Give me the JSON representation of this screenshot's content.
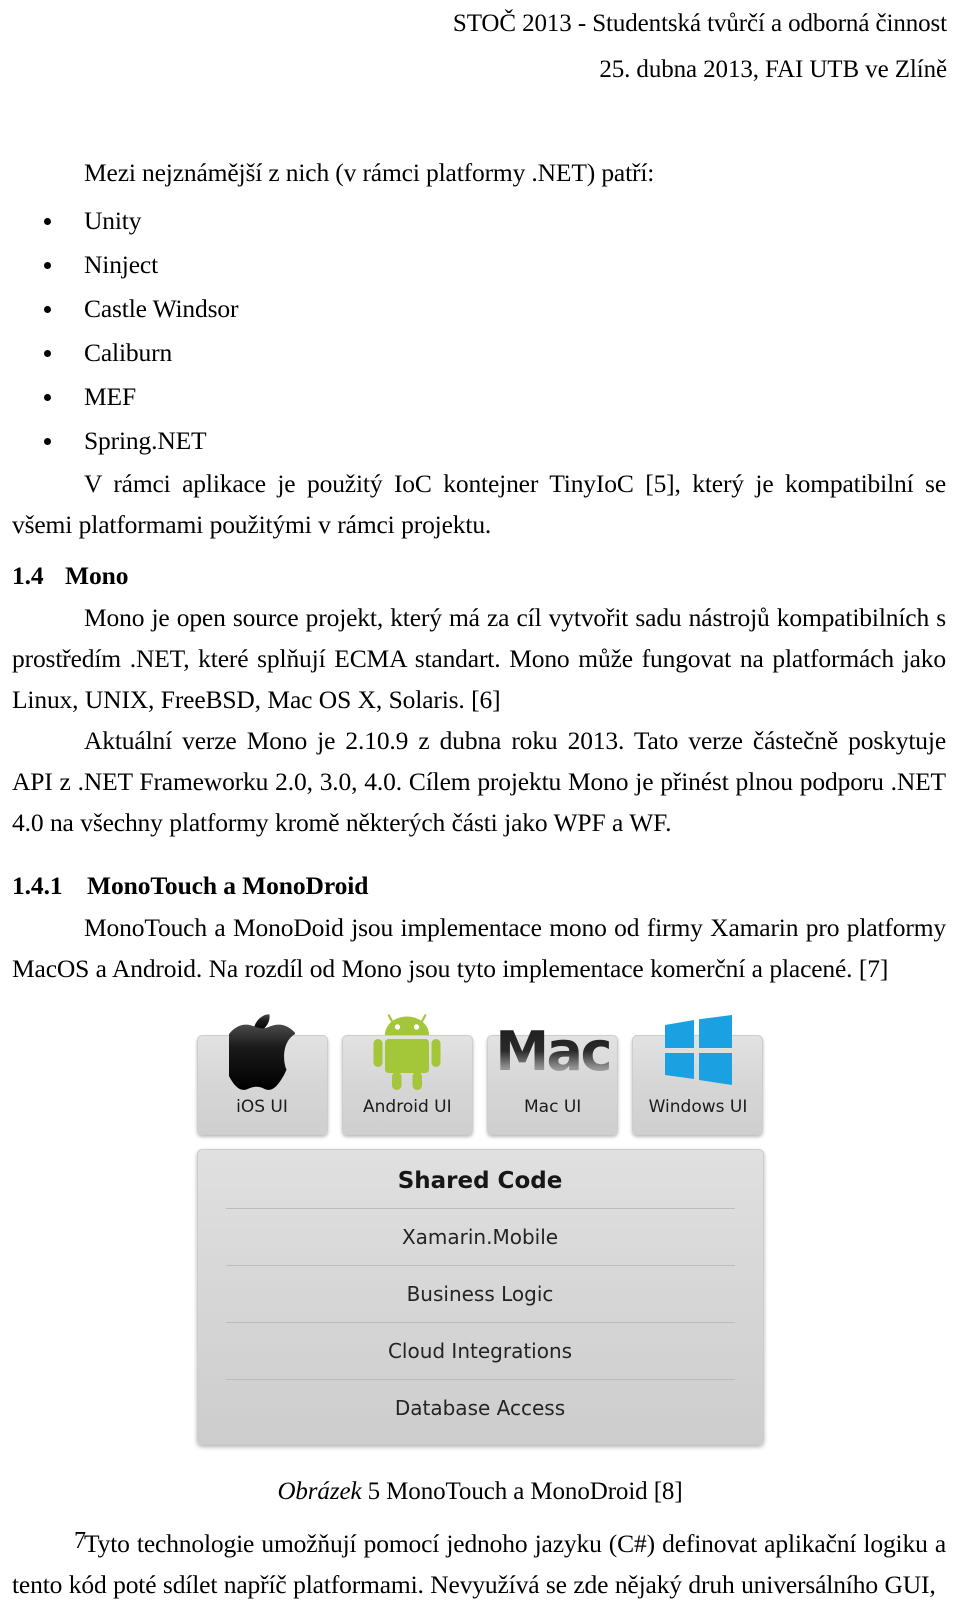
{
  "header": {
    "line1": "STOČ 2013 - Studentská tvůrčí a odborná činnost",
    "line2": "25. dubna 2013, FAI UTB ve Zlíně"
  },
  "content": {
    "intro_line": "Mezi nejznámější z nich (v rámci platformy .NET) patří:",
    "bullets": [
      {
        "label": "Unity"
      },
      {
        "label": "Ninject"
      },
      {
        "label": "Castle Windsor"
      },
      {
        "label": "Caliburn"
      },
      {
        "label": "MEF"
      },
      {
        "label": "Spring.NET"
      }
    ],
    "para_tinyioc": "V rámci aplikace je použitý IoC kontejner TinyIoC [5], který je kompatibilní se všemi platformami použitými v rámci projektu.",
    "heading_mono": {
      "num": "1.4",
      "title": "Mono"
    },
    "para_mono_1": "Mono je open source projekt, který má za cíl vytvořit sadu nástrojů kompatibilních s prostředím .NET, které splňují ECMA standart. Mono může fungovat na platformách jako Linux, UNIX, FreeBSD, Mac OS X, Solaris. [6]",
    "para_mono_2": "Aktuální verze Mono je 2.10.9 z dubna roku 2013. Tato verze částečně poskytuje API z .NET Frameworku 2.0, 3.0, 4.0. Cílem projektu Mono je přinést plnou podporu .NET 4.0 na všechny platformy kromě některých části jako WPF a WF.",
    "heading_monotouch": {
      "num": "1.4.1",
      "title": "MonoTouch a MonoDroid"
    },
    "para_monotouch": "MonoTouch a MonoDoid jsou implementace mono od firmy Xamarin pro platformy MacOS a Android. Na rozdíl od Mono jsou tyto implementace komerční a placené. [7]",
    "para_final": "Tyto technologie umožňují pomocí jednoho jazyku (C#) definovat aplikační logiku a tento kód poté sdílet napříč platformami. Nevyužívá se zde nějaký druh universálního GUI,"
  },
  "figure": {
    "os_tiles": [
      {
        "label": "iOS UI",
        "icon": "apple-logo-icon"
      },
      {
        "label": "Android UI",
        "icon": "android-robot-icon"
      },
      {
        "label": "Mac UI",
        "icon": "mac-wordmark-icon",
        "wordmark": "Mac"
      },
      {
        "label": "Windows UI",
        "icon": "windows-logo-icon"
      }
    ],
    "shared_title": "Shared Code",
    "shared_rows": [
      {
        "label": "Xamarin.Mobile"
      },
      {
        "label": "Business Logic"
      },
      {
        "label": "Cloud Integrations"
      },
      {
        "label": "Database Access"
      }
    ],
    "caption_label": "Obrázek",
    "caption_text": "5 MonoTouch a MonoDroid [8]",
    "colors": {
      "android_green": "#A4C639",
      "windows_blue": "#1BA1E2",
      "tile_gray": "#D7D7D7"
    }
  },
  "footer": {
    "page_number": "7"
  }
}
